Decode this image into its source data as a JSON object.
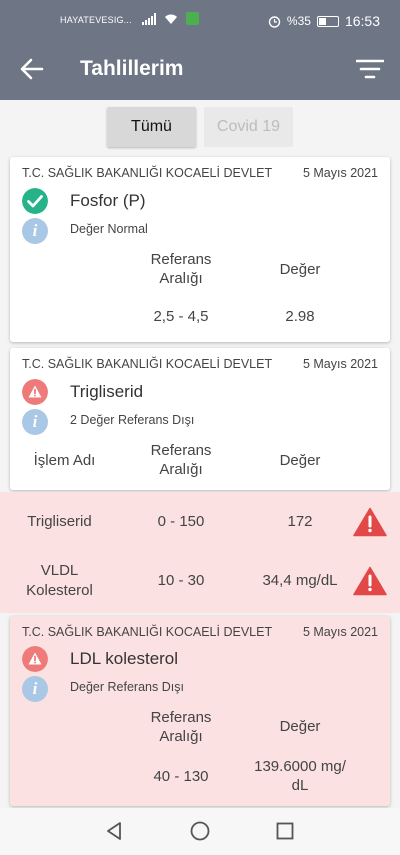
{
  "status_bar": {
    "carrier": "HAYATEVESIG...",
    "battery_percent": "%35",
    "time": "16:53"
  },
  "app_bar": {
    "title": "Tahlillerim"
  },
  "tabs": [
    {
      "label": "Tümü",
      "active": true
    },
    {
      "label": "Covid 19",
      "active": false
    }
  ],
  "cards": [
    {
      "hospital": "T.C. SAĞLIK BAKANLIĞI KOCAELİ DEVLET",
      "date": "5 Mayıs 2021",
      "test_name": "Fosfor (P)",
      "status": "Değer Normal",
      "status_type": "normal",
      "col_ref": "Referans\nAralığı",
      "col_value": "Değer",
      "ref_range": "2,5 - 4,5",
      "value": "2.98"
    },
    {
      "hospital": "T.C. SAĞLIK BAKANLIĞI KOCAELİ DEVLET",
      "date": "5 Mayıs 2021",
      "test_name": "Trigliserid",
      "status": "2 Değer Referans Dışı",
      "status_type": "warning",
      "col_name": "İşlem Adı",
      "col_ref": "Referans\nAralığı",
      "col_value": "Değer"
    },
    {
      "hospital": "T.C. SAĞLIK BAKANLIĞI KOCAELİ DEVLET",
      "date": "5 Mayıs 2021",
      "test_name": "LDL kolesterol",
      "status": "Değer Referans Dışı",
      "status_type": "warning",
      "col_ref": "Referans\nAralığı",
      "col_value": "Değer",
      "ref_range": "40 - 130",
      "value": "139.6000 mg/\ndL"
    }
  ],
  "sub_results": [
    {
      "name": "Trigliserid",
      "ref_range": "0 - 150",
      "value": "172"
    },
    {
      "name": "VLDL\nKolesterol",
      "ref_range": "10 - 30",
      "value": "34,4 mg/dL"
    }
  ],
  "colors": {
    "app_bar": "#6e7584",
    "normal_green": "#26b38a",
    "warning_red": "#ee5555",
    "out_of_range_bg": "#fbe1e1",
    "info_blue": "#a9c8e6"
  }
}
